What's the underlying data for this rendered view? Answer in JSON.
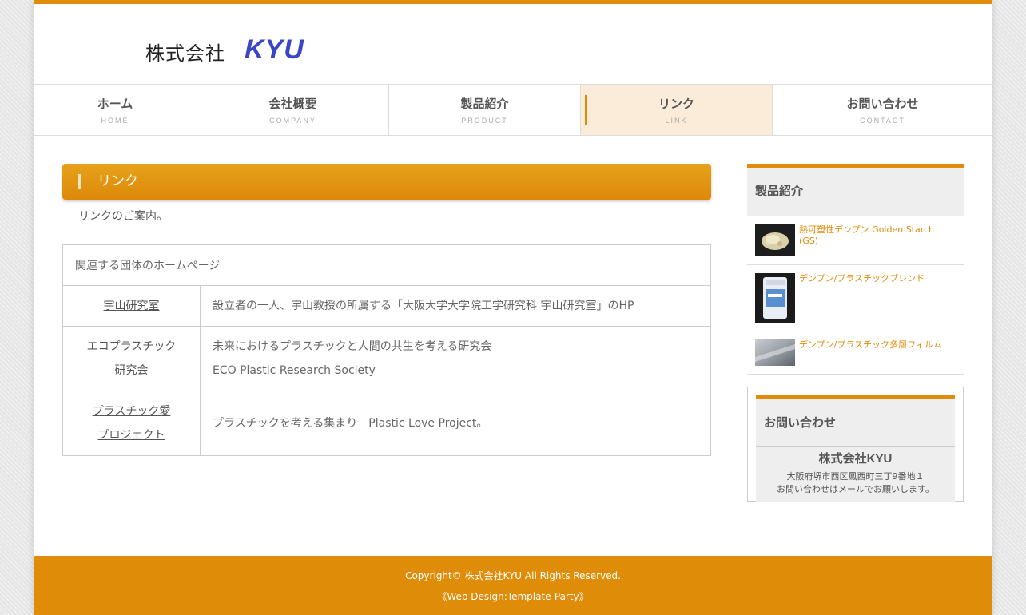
{
  "site": {
    "logo_kanji": "株式会社",
    "logo_en": "KYU"
  },
  "nav": [
    {
      "ja": "ホーム",
      "en": "HOME"
    },
    {
      "ja": "会社概要",
      "en": "COMPANY"
    },
    {
      "ja": "製品紹介",
      "en": "PRODUCT"
    },
    {
      "ja": "リンク",
      "en": "LINK"
    },
    {
      "ja": "お問い合わせ",
      "en": "CONTACT"
    }
  ],
  "main": {
    "title": "リンク",
    "intro": "リンクのご案内。",
    "table_caption": "関連する団体のホームページ",
    "rows": [
      {
        "name_l1": "宇山研究室",
        "name_l2": "",
        "desc_l1": "設立者の一人、宇山教授の所属する「大阪大学大学院工学研究科 宇山研究室」のHP",
        "desc_l2": ""
      },
      {
        "name_l1": "エコプラスチック",
        "name_l2": "研究会",
        "desc_l1": "未来におけるプラスチックと人間の共生を考える研究会",
        "desc_l2": "ECO Plastic Research Society"
      },
      {
        "name_l1": "プラスチック愛",
        "name_l2": "プロジェクト",
        "desc_l1": "プラスチックを考える集まり　Plastic Love Project。",
        "desc_l2": ""
      }
    ]
  },
  "sidebar": {
    "products_title": "製品紹介",
    "products": [
      {
        "name": "熱可塑性デンプン Golden Starch (GS)"
      },
      {
        "name": "デンプン/プラスチックブレンド"
      },
      {
        "name": "デンプン/プラスチック多層フィルム"
      }
    ],
    "contact_title": "お問い合わせ",
    "company": "株式会社KYU",
    "address": "大阪府堺市西区鳳西町三丁9番地１",
    "note": "お問い合わせはメールでお願いします。"
  },
  "footer": {
    "copyright": "Copyright© 株式会社KYU All Rights Reserved.",
    "design": "《Web Design:Template-Party》"
  },
  "colors": {
    "accent": "#df8c09",
    "logo_blue": "#3a45c8",
    "nav_active_bg": "#fbecd9"
  }
}
